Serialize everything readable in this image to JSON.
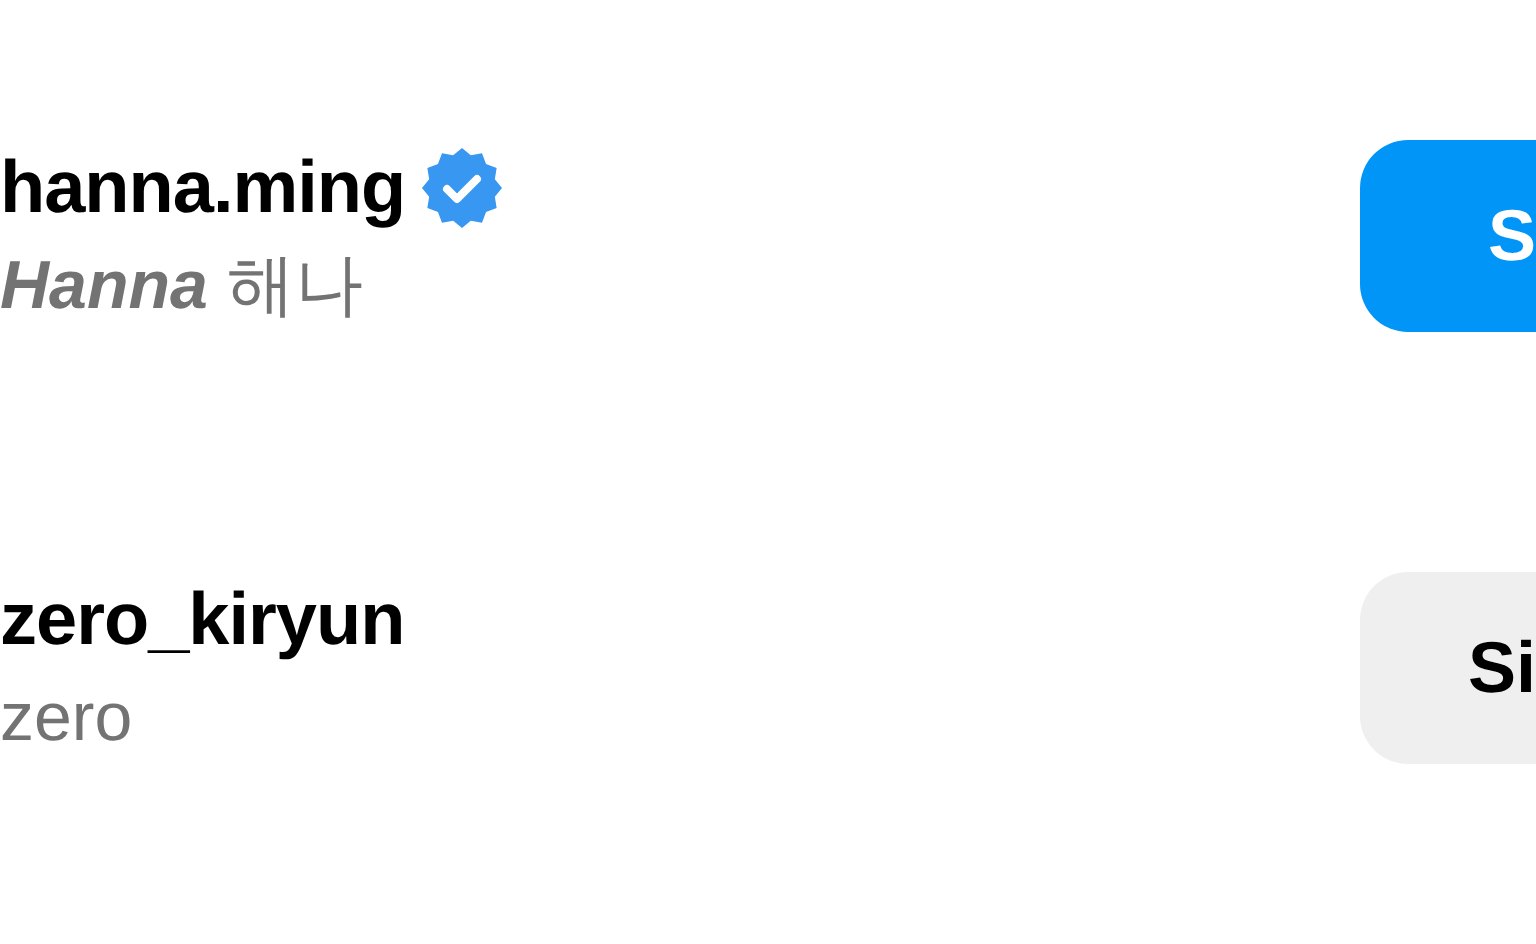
{
  "accounts": [
    {
      "username": "hanna.ming",
      "verified": true,
      "name": "**Hanna** 해나",
      "button": {
        "label": "S",
        "following": false
      }
    },
    {
      "username": "zero_kiryun",
      "verified": false,
      "name": "zero",
      "button": {
        "label": "Si",
        "following": true
      }
    }
  ]
}
